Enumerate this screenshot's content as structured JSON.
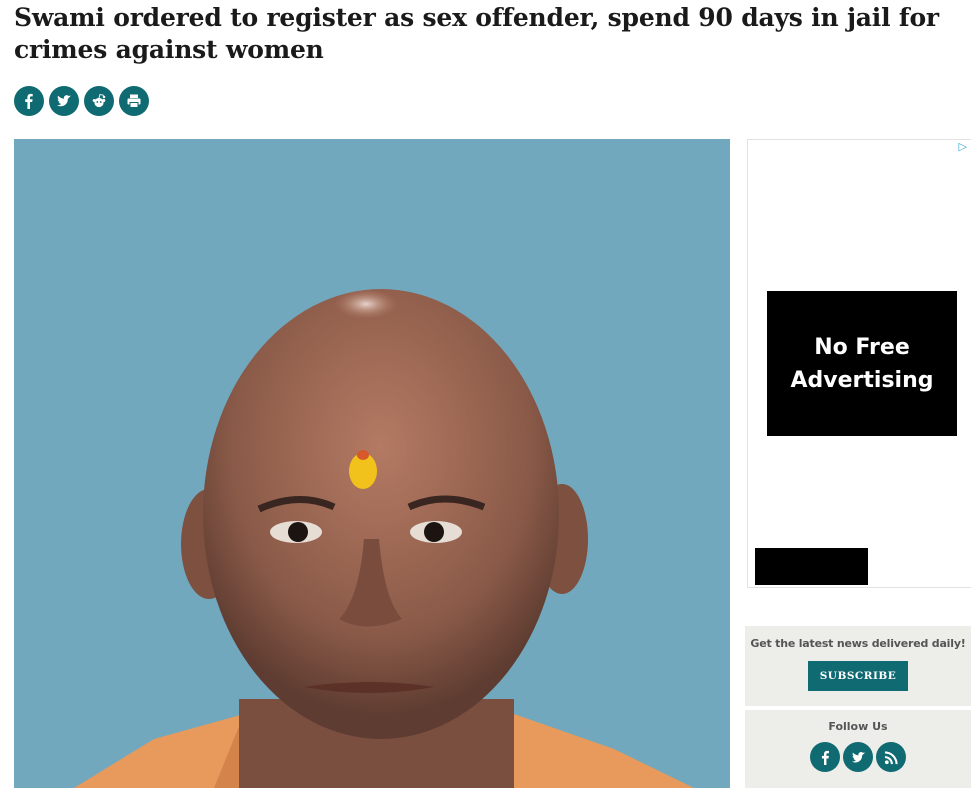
{
  "article": {
    "headline": "Swami ordered to register as sex offender, spend 90 days in jail for crimes against women"
  },
  "share": {
    "icons": [
      "facebook-icon",
      "twitter-icon",
      "reddit-icon",
      "print-icon"
    ]
  },
  "ad": {
    "line1": "No Free",
    "line2": "Advertising",
    "choice_icon": "play-triangle-icon"
  },
  "sidebar": {
    "newsletter_text": "Get the latest news delivered daily!",
    "subscribe_label": "SUBSCRIBE",
    "follow_text": "Follow Us",
    "follow_icons": [
      "facebook-icon",
      "twitter-icon",
      "rss-icon"
    ]
  },
  "colors": {
    "accent": "#0f6a72",
    "photo_background": "#72a8bd",
    "sidebar_bg": "#ededea"
  }
}
